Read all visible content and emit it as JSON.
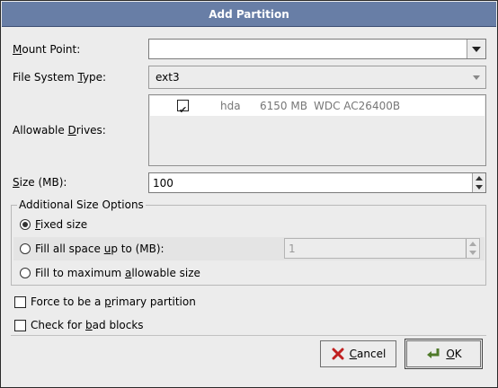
{
  "window": {
    "title": "Add Partition"
  },
  "mount_point": {
    "label_pre": "",
    "label_u": "M",
    "label_post": "ount Point:",
    "value": ""
  },
  "fs_type": {
    "label_pre": "File System ",
    "label_u": "T",
    "label_post": "ype:",
    "value": "ext3"
  },
  "drives": {
    "label_pre": "Allowable ",
    "label_u": "D",
    "label_post": "rives:",
    "rows": [
      {
        "checked": true,
        "name": "hda",
        "size": "6150 MB",
        "model": "WDC AC26400B"
      }
    ]
  },
  "size": {
    "label_pre": "",
    "label_u": "S",
    "label_post": "ize (MB):",
    "value": "100"
  },
  "options": {
    "title": "Additional Size Options",
    "fixed": {
      "label_pre": "",
      "label_u": "F",
      "label_post": "ixed size",
      "selected": true
    },
    "fill_upto": {
      "label_pre": "Fill all space ",
      "label_u": "u",
      "label_post": "p to (MB):",
      "value": "1",
      "selected": false
    },
    "fill_max": {
      "label_pre": "Fill to maximum ",
      "label_u": "a",
      "label_post": "llowable size",
      "selected": false
    }
  },
  "primary": {
    "label_pre": "Force to be a ",
    "label_u": "p",
    "label_post": "rimary partition",
    "checked": false
  },
  "badblocks": {
    "label_pre": "Check for ",
    "label_u": "b",
    "label_post": "ad blocks",
    "checked": false
  },
  "buttons": {
    "cancel": {
      "label_pre": "",
      "label_u": "C",
      "label_post": "ancel"
    },
    "ok": {
      "label_pre": "",
      "label_u": "O",
      "label_post": "K"
    }
  },
  "colors": {
    "titlebar": "#687ea6",
    "dialog_bg": "#ececec",
    "desktop": "#5a6a88"
  }
}
